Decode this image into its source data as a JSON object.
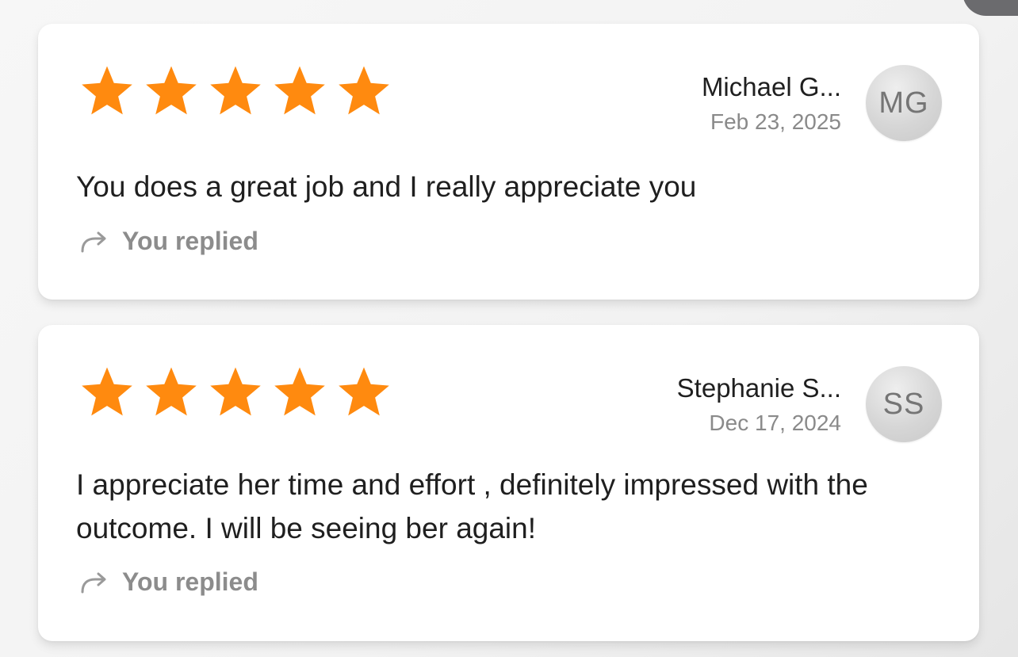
{
  "colors": {
    "star": "#ff8a0f",
    "text": "#1f1f1f",
    "muted": "#8a8a8a",
    "avatar_bg": "#d6d6d6"
  },
  "reviews": [
    {
      "rating": 5,
      "max_rating": 5,
      "reviewer_name": "Michael G...",
      "initials": "MG",
      "date": "Feb 23, 2025",
      "text": "You does a great job and I really appreciate you",
      "reply_icon": "reply-arrow-icon",
      "reply_label": "You replied"
    },
    {
      "rating": 5,
      "max_rating": 5,
      "reviewer_name": "Stephanie S...",
      "initials": "SS",
      "date": "Dec 17, 2024",
      "text": "I appreciate her time and effort , definitely impressed with the outcome. I will be seeing ber again!",
      "reply_icon": "reply-arrow-icon",
      "reply_label": "You replied"
    }
  ]
}
